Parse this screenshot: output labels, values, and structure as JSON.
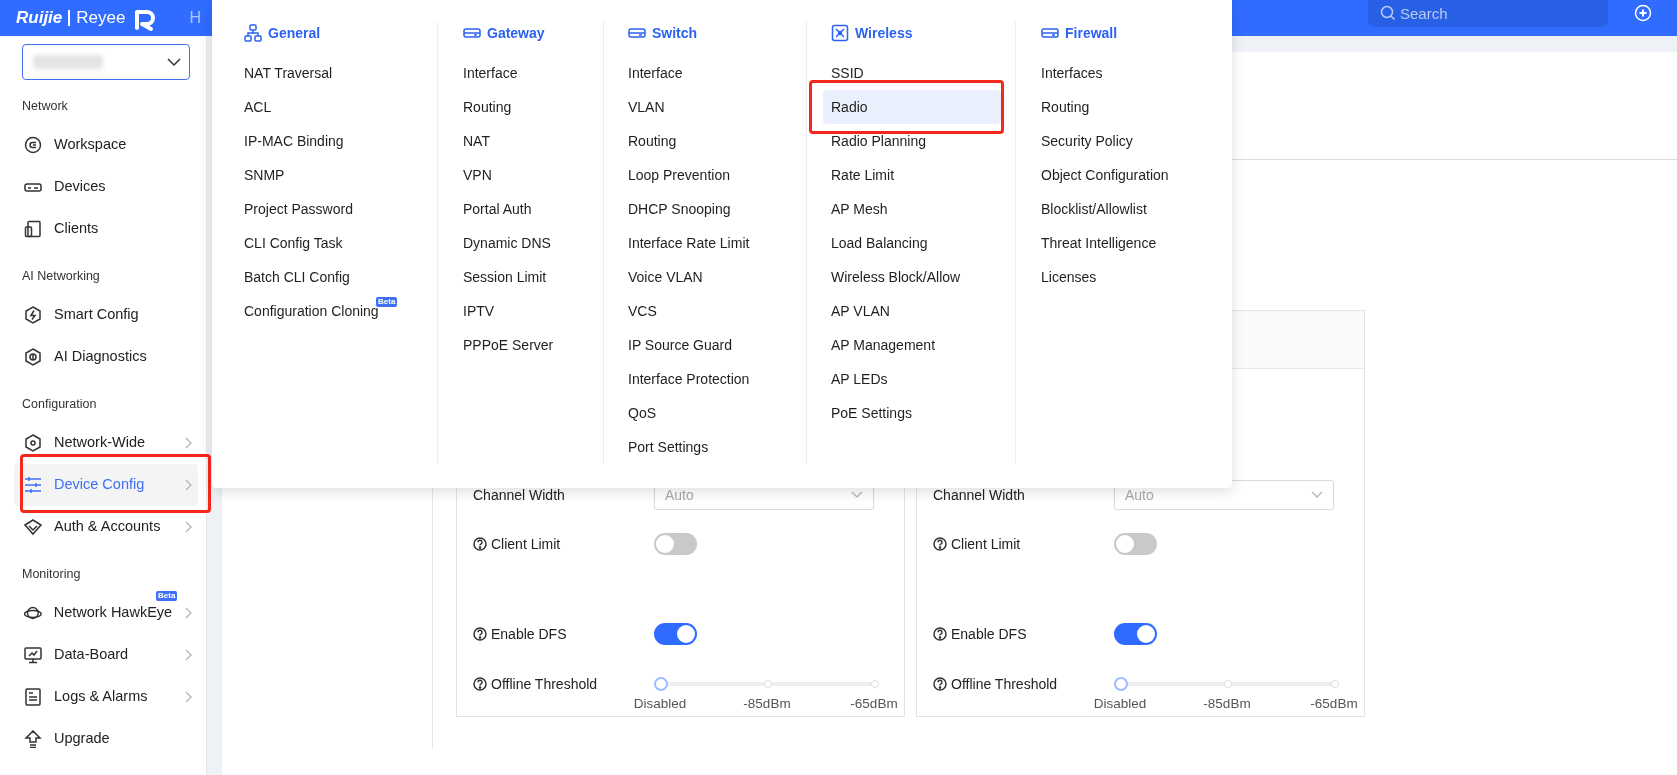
{
  "header": {
    "brand": "Ruijie",
    "product": "Reyee",
    "nav_item": "H",
    "search": {
      "placeholder": "Search"
    }
  },
  "sidebar": {
    "sections": [
      {
        "title": "Network",
        "items": [
          {
            "label": "Workspace",
            "has_submenu": false,
            "selected": false,
            "annotated": false
          },
          {
            "label": "Devices",
            "has_submenu": false,
            "selected": false,
            "annotated": false
          },
          {
            "label": "Clients",
            "has_submenu": false,
            "selected": false,
            "annotated": false
          }
        ]
      },
      {
        "title": "AI Networking",
        "items": [
          {
            "label": "Smart Config",
            "has_submenu": false,
            "selected": false,
            "annotated": false
          },
          {
            "label": "AI Diagnostics",
            "has_submenu": false,
            "selected": false,
            "annotated": false
          }
        ]
      },
      {
        "title": "Configuration",
        "items": [
          {
            "label": "Network-Wide",
            "has_submenu": true,
            "selected": false,
            "annotated": false
          },
          {
            "label": "Device Config",
            "has_submenu": true,
            "selected": true,
            "annotated": true
          },
          {
            "label": "Auth & Accounts",
            "has_submenu": true,
            "selected": false,
            "annotated": false
          }
        ]
      },
      {
        "title": "Monitoring",
        "items": [
          {
            "label": "Network HawkEye",
            "has_submenu": true,
            "selected": false,
            "annotated": false,
            "badge": "Beta"
          },
          {
            "label": "Data-Board",
            "has_submenu": true,
            "selected": false,
            "annotated": false
          },
          {
            "label": "Logs & Alarms",
            "has_submenu": true,
            "selected": false,
            "annotated": false
          },
          {
            "label": "Upgrade",
            "has_submenu": false,
            "selected": false,
            "annotated": false
          }
        ]
      }
    ]
  },
  "menu": {
    "columns": [
      {
        "title": "General",
        "items": [
          {
            "label": "NAT Traversal",
            "selected": false,
            "annotated": false
          },
          {
            "label": "ACL",
            "selected": false,
            "annotated": false
          },
          {
            "label": "IP-MAC Binding",
            "selected": false,
            "annotated": false
          },
          {
            "label": "SNMP",
            "selected": false,
            "annotated": false
          },
          {
            "label": "Project Password",
            "selected": false,
            "annotated": false
          },
          {
            "label": "CLI Config Task",
            "selected": false,
            "annotated": false
          },
          {
            "label": "Batch CLI Config",
            "selected": false,
            "annotated": false
          },
          {
            "label": "Configuration Cloning",
            "selected": false,
            "annotated": false,
            "badge": "Beta"
          }
        ]
      },
      {
        "title": "Gateway",
        "items": [
          {
            "label": "Interface",
            "selected": false,
            "annotated": false
          },
          {
            "label": "Routing",
            "selected": false,
            "annotated": false
          },
          {
            "label": "NAT",
            "selected": false,
            "annotated": false
          },
          {
            "label": "VPN",
            "selected": false,
            "annotated": false
          },
          {
            "label": "Portal Auth",
            "selected": false,
            "annotated": false
          },
          {
            "label": "Dynamic DNS",
            "selected": false,
            "annotated": false
          },
          {
            "label": "Session Limit",
            "selected": false,
            "annotated": false
          },
          {
            "label": "IPTV",
            "selected": false,
            "annotated": false
          },
          {
            "label": "PPPoE Server",
            "selected": false,
            "annotated": false
          }
        ]
      },
      {
        "title": "Switch",
        "items": [
          {
            "label": "Interface",
            "selected": false,
            "annotated": false
          },
          {
            "label": "VLAN",
            "selected": false,
            "annotated": false
          },
          {
            "label": "Routing",
            "selected": false,
            "annotated": false
          },
          {
            "label": "Loop Prevention",
            "selected": false,
            "annotated": false
          },
          {
            "label": "DHCP Snooping",
            "selected": false,
            "annotated": false
          },
          {
            "label": "Interface Rate Limit",
            "selected": false,
            "annotated": false
          },
          {
            "label": "Voice VLAN",
            "selected": false,
            "annotated": false
          },
          {
            "label": "VCS",
            "selected": false,
            "annotated": false
          },
          {
            "label": "IP Source Guard",
            "selected": false,
            "annotated": false
          },
          {
            "label": "Interface Protection",
            "selected": false,
            "annotated": false
          },
          {
            "label": "QoS",
            "selected": false,
            "annotated": false
          },
          {
            "label": "Port Settings",
            "selected": false,
            "annotated": false
          }
        ]
      },
      {
        "title": "Wireless",
        "items": [
          {
            "label": "SSID",
            "selected": false,
            "annotated": false
          },
          {
            "label": "Radio",
            "selected": true,
            "annotated": true
          },
          {
            "label": "Radio Planning",
            "selected": false,
            "annotated": false
          },
          {
            "label": "Rate Limit",
            "selected": false,
            "annotated": false
          },
          {
            "label": "AP Mesh",
            "selected": false,
            "annotated": false
          },
          {
            "label": "Load Balancing",
            "selected": false,
            "annotated": false
          },
          {
            "label": "Wireless Block/Allow",
            "selected": false,
            "annotated": false
          },
          {
            "label": "AP VLAN",
            "selected": false,
            "annotated": false
          },
          {
            "label": "AP Management",
            "selected": false,
            "annotated": false
          },
          {
            "label": "AP LEDs",
            "selected": false,
            "annotated": false
          },
          {
            "label": "PoE Settings",
            "selected": false,
            "annotated": false
          }
        ]
      },
      {
        "title": "Firewall",
        "items": [
          {
            "label": "Interfaces",
            "selected": false,
            "annotated": false
          },
          {
            "label": "Routing",
            "selected": false,
            "annotated": false
          },
          {
            "label": "Security Policy",
            "selected": false,
            "annotated": false
          },
          {
            "label": "Object Configuration",
            "selected": false,
            "annotated": false
          },
          {
            "label": "Blocklist/Allowlist",
            "selected": false,
            "annotated": false
          },
          {
            "label": "Threat Intelligence",
            "selected": false,
            "annotated": false
          },
          {
            "label": "Licenses",
            "selected": false,
            "annotated": false
          }
        ]
      }
    ]
  },
  "radio_cards": [
    {
      "fields": [
        {
          "kind": "select",
          "label": "Channel Width",
          "help": false,
          "value": "Auto"
        },
        {
          "kind": "toggle",
          "label": "Client Limit",
          "help": true,
          "on": false
        },
        {
          "kind": "toggle",
          "label": "Enable DFS",
          "help": true,
          "on": true
        },
        {
          "kind": "slider",
          "label": "Offline Threshold",
          "help": true,
          "level": 0,
          "marks": [
            "Disabled",
            "-85dBm",
            "-65dBm"
          ]
        }
      ]
    },
    {
      "fields": [
        {
          "kind": "select",
          "label": "Channel Width",
          "help": false,
          "value": "Auto"
        },
        {
          "kind": "toggle",
          "label": "Client Limit",
          "help": true,
          "on": false
        },
        {
          "kind": "toggle",
          "label": "Enable DFS",
          "help": true,
          "on": true
        },
        {
          "kind": "slider",
          "label": "Offline Threshold",
          "help": true,
          "level": 0,
          "marks": [
            "Disabled",
            "-85dBm",
            "-65dBm"
          ]
        }
      ]
    }
  ]
}
